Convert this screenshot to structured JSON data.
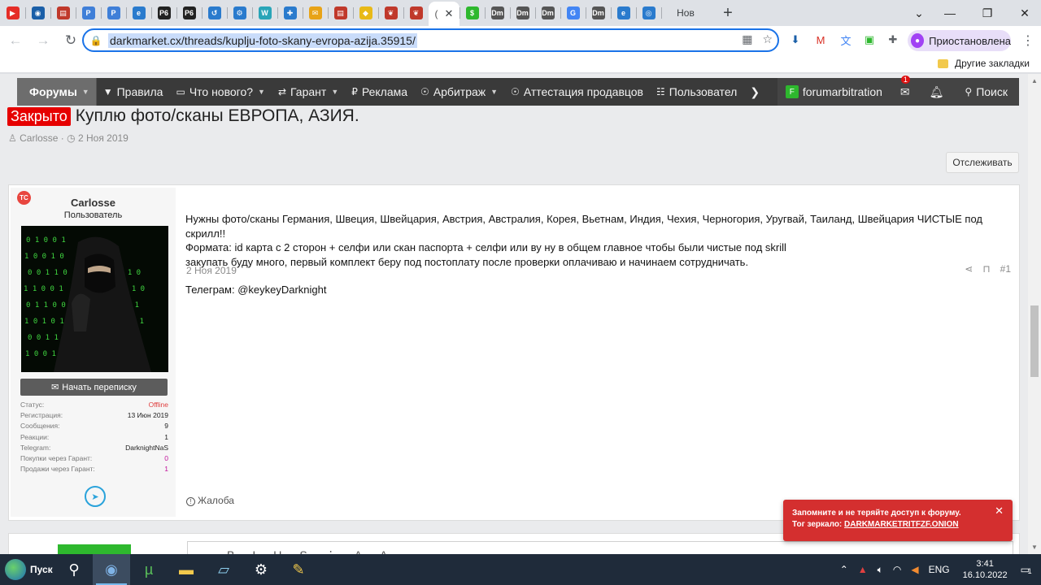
{
  "browser": {
    "tabs": [
      {
        "icon": "youtube-icon",
        "color": "#e52d27",
        "glyph": "▶"
      },
      {
        "icon": "circle-app-icon",
        "color": "#1a5fa8",
        "glyph": "◉"
      },
      {
        "icon": "docs-icon",
        "color": "#c0392b",
        "glyph": "▤"
      },
      {
        "icon": "p-icon",
        "color": "#3f7fd8",
        "glyph": "P"
      },
      {
        "icon": "p-icon",
        "color": "#3f7fd8",
        "glyph": "P"
      },
      {
        "icon": "edge-icon",
        "color": "#2a7bcd",
        "glyph": "e"
      },
      {
        "icon": "p6-icon",
        "color": "#222222",
        "glyph": "P6"
      },
      {
        "icon": "p6-icon",
        "color": "#222222",
        "glyph": "P6"
      },
      {
        "icon": "history-icon",
        "color": "#2a7bcd",
        "glyph": "↺"
      },
      {
        "icon": "gear-icon",
        "color": "#2a7bcd",
        "glyph": "⚙"
      },
      {
        "icon": "w-icon",
        "color": "#29a5b8",
        "glyph": "W"
      },
      {
        "icon": "puzzle-icon",
        "color": "#2a7bcd",
        "glyph": "✚"
      },
      {
        "icon": "mail-icon",
        "color": "#e8a317",
        "glyph": "✉"
      },
      {
        "icon": "docs-icon",
        "color": "#c0392b",
        "glyph": "▤"
      },
      {
        "icon": "coin-icon",
        "color": "#e8b917",
        "glyph": "◆"
      },
      {
        "icon": "shield-icon",
        "color": "#c0392b",
        "glyph": "❦"
      },
      {
        "icon": "shield-icon",
        "color": "#c0392b",
        "glyph": "❦"
      }
    ],
    "active_tab": {
      "label": "(",
      "close": "✕"
    },
    "more_tabs": [
      {
        "icon": "dollar-icon",
        "color": "#2eb82e",
        "glyph": "$"
      },
      {
        "icon": "dm-icon",
        "color": "#555555",
        "glyph": "Dm"
      },
      {
        "icon": "dm-icon",
        "color": "#555555",
        "glyph": "Dm"
      },
      {
        "icon": "dm-icon",
        "color": "#555555",
        "glyph": "Dm"
      },
      {
        "icon": "google-icon",
        "color": "#4285f4",
        "glyph": "G"
      },
      {
        "icon": "dm-icon",
        "color": "#555555",
        "glyph": "Dm"
      },
      {
        "icon": "edge-icon",
        "color": "#2a7bcd",
        "glyph": "e"
      },
      {
        "icon": "refresh-icon",
        "color": "#2a7bcd",
        "glyph": "◎"
      }
    ],
    "last_tab_title": "Нов",
    "url": "darkmarket.cx/threads/kuplju-foto-skany-evropa-azija.35915/",
    "profile_label": "Приостановлена",
    "bookmarks_label": "Другие закладки"
  },
  "forum": {
    "nav": [
      {
        "label": "Форумы",
        "icon": "",
        "caret": true
      },
      {
        "label": "Правила",
        "icon": "▼",
        "caret": false
      },
      {
        "label": "Что нового?",
        "icon": "▭",
        "caret": true
      },
      {
        "label": "Гарант",
        "icon": "⇄",
        "caret": true
      },
      {
        "label": "Реклама",
        "icon": "₽",
        "caret": false
      },
      {
        "label": "Арбитраж",
        "icon": "☉",
        "caret": true
      },
      {
        "label": "Аттестация продавцов",
        "icon": "☉",
        "caret": false
      },
      {
        "label": "Пользовател",
        "icon": "☷",
        "caret": false
      }
    ],
    "nav_more": "❯",
    "account_name": "forumarbitration",
    "account_badge": "F",
    "inbox_count": "1",
    "search_label": "Поиск",
    "thread": {
      "prefix": "Закрыто",
      "title": "Куплю фото/сканы ЕВРОПА, АЗИЯ.",
      "author": "Carlosse",
      "date": "2 Ноя 2019",
      "watch_label": "Отслеживать"
    },
    "post": {
      "badge": "TC",
      "username": "Carlosse",
      "role": "Пользователь",
      "message_button": "Начать переписку",
      "stats": [
        {
          "label": "Статус:",
          "value": "Offline",
          "style": "red"
        },
        {
          "label": "Регистрация:",
          "value": "13 Июн 2019",
          "style": ""
        },
        {
          "label": "Сообщения:",
          "value": "9",
          "style": ""
        },
        {
          "label": "Реакции:",
          "value": "1",
          "style": ""
        },
        {
          "label": "Telegram:",
          "value": "DarknightNaS",
          "style": ""
        },
        {
          "label": "Покупки через Гарант:",
          "value": "0",
          "style": "mag"
        },
        {
          "label": "Продажи через Гарант:",
          "value": "1",
          "style": "mag"
        }
      ],
      "date": "2 Ноя 2019",
      "number": "#1",
      "body": [
        "Нужны фото/сканы Германия, Швеция, Швейцария, Австрия, Австралия, Корея, Вьетнам, Индия, Чехия, Черногория, Уругвай, Таиланд, Швейцария ЧИСТЫЕ под скрилл!!",
        "Формата: id карта с 2 сторон + селфи или скан паспорта + селфи или ву ну в общем главное чтобы были чистые под skrill",
        "закупать буду много, первый комплект беру под постоплату после проверки оплачиваю и начинаем сотрудничать."
      ],
      "telegram_line": "Телеграм: @keykeyDarknight",
      "report_label": "Жалоба"
    },
    "toast": {
      "line1": "Запомните и не теряйте доступ к форуму.",
      "line2_prefix": "Тог зеркало: ",
      "mirror": "DARKMARKETRITFZF.ONION"
    }
  },
  "taskbar": {
    "start_label": "Пуск",
    "lang": "ENG",
    "time": "3:41",
    "date": "16.10.2022",
    "notifications": "1"
  },
  "colors": {
    "accent": "#1a73e8",
    "closed_label": "#e60000",
    "toast": "#d42f2f",
    "nav_bg": "#3a3a3a"
  }
}
